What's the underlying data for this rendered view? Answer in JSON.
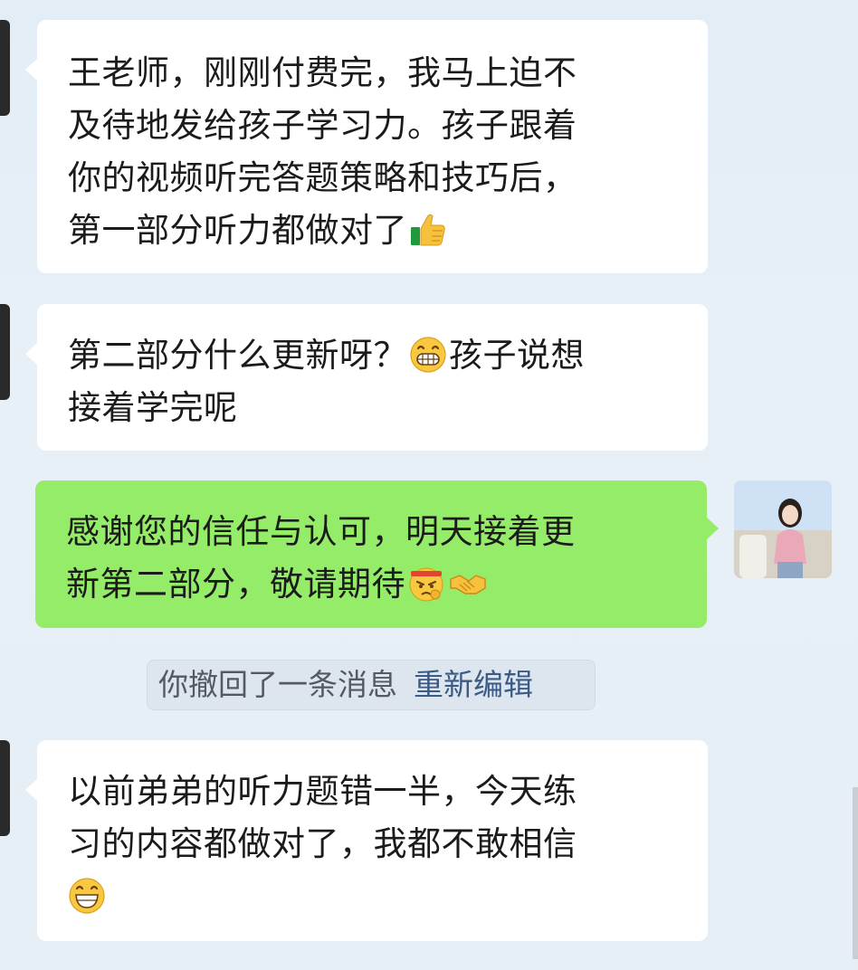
{
  "messages": [
    {
      "from": "contact",
      "lines": [
        "王老师，刚刚付费完，我马上迫不",
        "及待地发给孩子学习力。孩子跟着",
        "你的视频听完答题策略和技巧后，",
        "第一部分听力都做对了"
      ],
      "trailing_emoji": "thumbs-up"
    },
    {
      "from": "contact",
      "line1_a": "第二部分什么更新呀？",
      "line1_emoji": "grinning-face",
      "line1_b": "孩子说想",
      "line2": "接着学完呢"
    },
    {
      "from": "me",
      "line1": "感谢您的信任与认可，明天接着更",
      "line2": "新第二部分，敬请期待",
      "emojis": [
        "determined-face",
        "handshake"
      ]
    },
    {
      "from": "contact",
      "lines": [
        "以前弟弟的听力题错一半，今天练",
        "习的内容都做对了，我都不敢相信"
      ],
      "trailing_emoji": "laughing-face"
    }
  ],
  "system_notice": {
    "text": "你撤回了一条消息",
    "action": "重新编辑"
  },
  "colors": {
    "incoming_bubble": "#ffffff",
    "outgoing_bubble": "#95ec69",
    "background": "#e6eef6",
    "link": "#3b5b86"
  }
}
